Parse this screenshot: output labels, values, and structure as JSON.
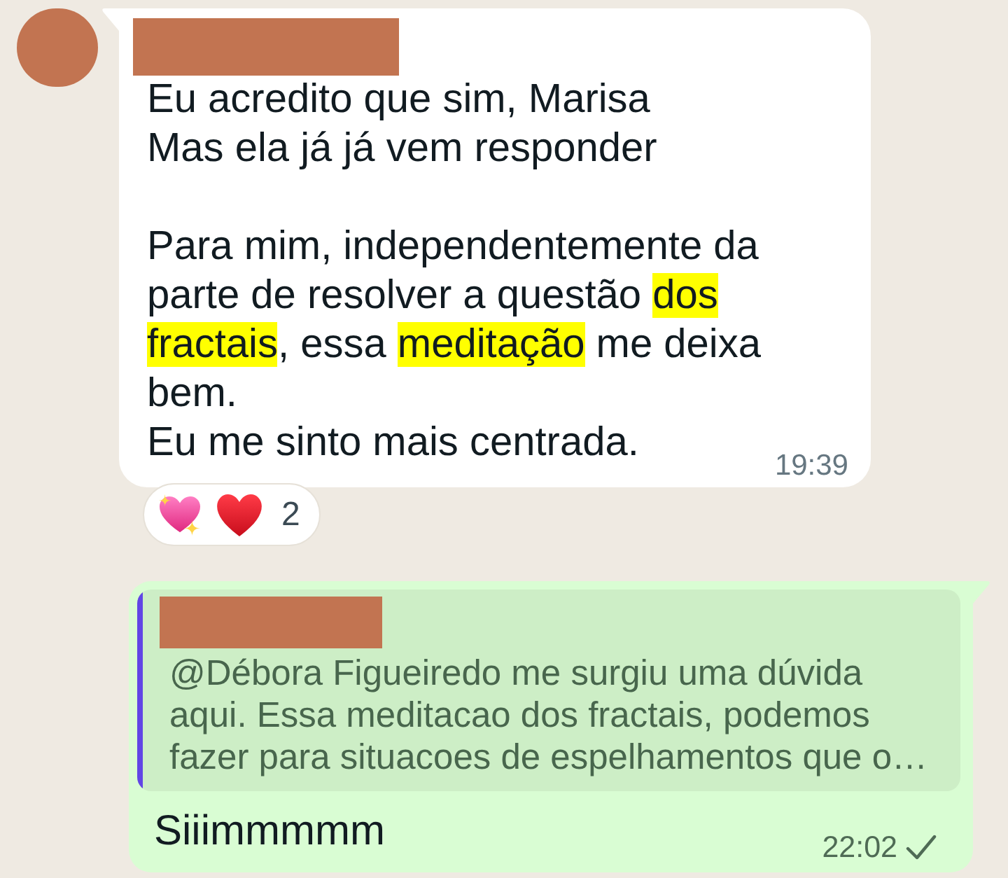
{
  "messages": [
    {
      "kind": "incoming",
      "sender_redacted": true,
      "segments": [
        {
          "text": "Eu acredito que sim, Marisa\nMas ela já já vem responder\n\nPara mim, independentemente da parte de resolver a questão ",
          "highlighted": false
        },
        {
          "text": "dos fractais",
          "highlighted": true
        },
        {
          "text": ", essa ",
          "highlighted": false
        },
        {
          "text": "meditação",
          "highlighted": true
        },
        {
          "text": " me deixa bem.\nEu me sinto mais centrada.",
          "highlighted": false
        }
      ],
      "time": "19:39",
      "reactions": {
        "emojis": [
          {
            "kind": "sparkling-heart"
          },
          {
            "kind": "red-heart"
          }
        ],
        "count": "2"
      }
    },
    {
      "kind": "outgoing",
      "quote": {
        "author_redacted": true,
        "text": "@Débora Figueiredo me surgiu uma dúvida aqui. Essa meditacao dos fractais, podemos fazer para situacoes de espelhamentos que o…"
      },
      "text": "Siiimmmmm",
      "time": "22:02",
      "sent": true
    }
  ]
}
